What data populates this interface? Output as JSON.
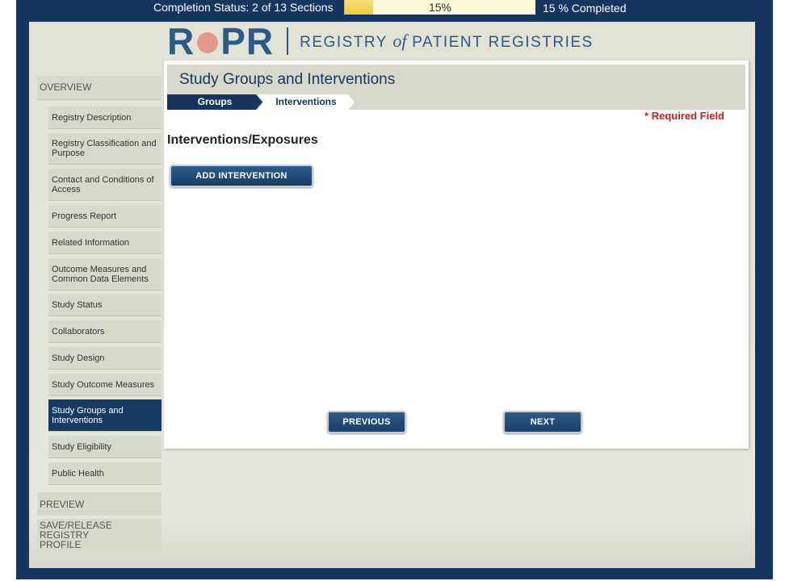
{
  "status": {
    "label": "Completion Status: 2 of 13 Sections",
    "progress_percent": 15,
    "progress_text": "15%",
    "summary": "15 % Completed"
  },
  "logo": {
    "ropr_r": "R",
    "ropr_pr": "PR",
    "tag_registry": "REGISTRY",
    "tag_of": "of",
    "tag_patient": "PATIENT REGISTRIES"
  },
  "sidebar": {
    "overview": "OVERVIEW",
    "items": [
      {
        "label": "Registry Description"
      },
      {
        "label": "Registry Classification and Purpose"
      },
      {
        "label": "Contact and Conditions of Access"
      },
      {
        "label": "Progress Report"
      },
      {
        "label": "Related Information"
      },
      {
        "label": "Outcome Measures and Common Data Elements"
      },
      {
        "label": "Study Status"
      },
      {
        "label": "Collaborators"
      },
      {
        "label": "Study Design"
      },
      {
        "label": "Study Outcome Measures"
      },
      {
        "label": "Study Groups and Interventions"
      },
      {
        "label": "Study Eligibility"
      },
      {
        "label": "Public Health"
      }
    ],
    "preview": "PREVIEW",
    "save_release": "SAVE/RELEASE REGISTRY PROFILE"
  },
  "content": {
    "title": "Study Groups and Interventions",
    "crumb_groups": "Groups",
    "crumb_interventions": "Interventions",
    "required": "* Required Field",
    "section_title": "Interventions/Exposures",
    "add_button": "ADD INTERVENTION",
    "previous_button": "PREVIOUS",
    "next_button": "NEXT"
  },
  "colors": {
    "navy": "#17365f",
    "accent": "#2a5a85",
    "required": "#d11b1b",
    "progress_fill": "#f0c93f"
  }
}
